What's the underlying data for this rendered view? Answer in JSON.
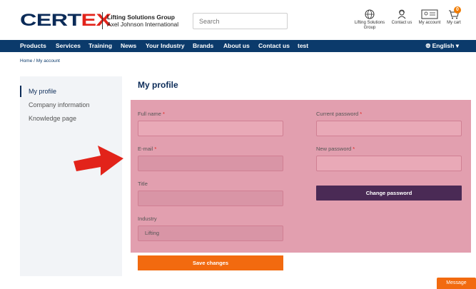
{
  "header": {
    "logo_word_a": "CERT",
    "logo_word_b": "EX",
    "tag_line1": "Lifting Solutions Group",
    "tag_line2": "Axel Johnson International",
    "search_placeholder": "Search",
    "icons": [
      {
        "name": "globe-icon",
        "label_line1": "Lifting Solutions",
        "label_line2": "Group"
      },
      {
        "name": "contact-icon",
        "label_line1": "Contact us",
        "label_line2": ""
      },
      {
        "name": "account-icon",
        "label_line1": "My account",
        "label_line2": ""
      },
      {
        "name": "cart-icon",
        "label_line1": "My cart",
        "label_line2": ""
      }
    ],
    "cart_count": "0"
  },
  "nav": {
    "items": [
      "Products",
      "Services",
      "Training",
      "News",
      "Your Industry",
      "Brands",
      "About us",
      "Contact us",
      "test"
    ],
    "language": "English"
  },
  "breadcrumb": "Home / My account",
  "sidebar": {
    "items": [
      "My profile",
      "Company information",
      "Knowledge page"
    ]
  },
  "main": {
    "title": "My profile",
    "full_name_label": "Full name",
    "email_label": "E-mail",
    "title_label": "Title",
    "industry_label": "Industry",
    "industry_value": "Lifting",
    "current_password_label": "Current password",
    "new_password_label": "New password",
    "required_mark": "*",
    "change_password": "Change password",
    "save_changes": "Save changes"
  },
  "message_button": "Message",
  "colors": {
    "brand_navy": "#0b2b58",
    "nav_blue": "#0b3a6b",
    "accent_orange": "#f26a0f",
    "highlight_pink": "#e29faf",
    "button_purple": "#4a2a55",
    "arrow_red": "#e2231a"
  }
}
